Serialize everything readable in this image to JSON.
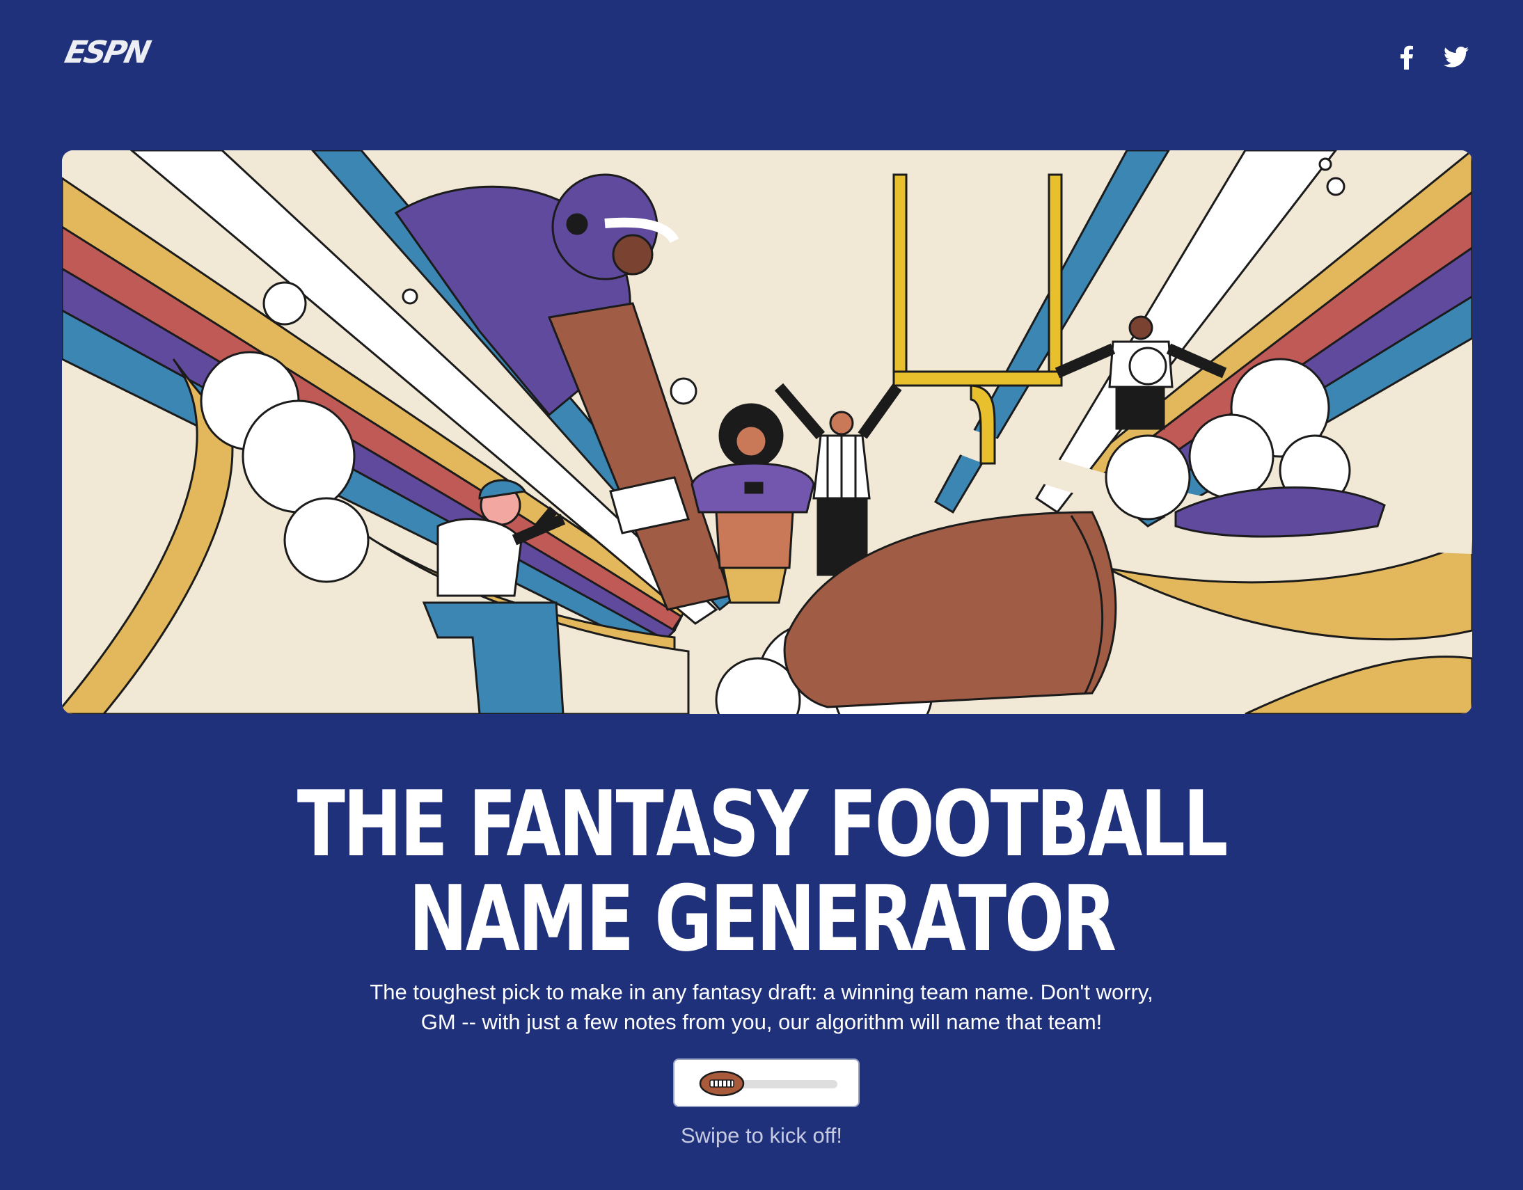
{
  "header": {
    "logo_text": "ESPN",
    "social": [
      {
        "name": "facebook-icon"
      },
      {
        "name": "twitter-icon"
      }
    ]
  },
  "hero": {
    "alt": "Illustration of fans, players and referees around a football and goal post",
    "colors": {
      "background": "#20317b",
      "purple": "#5f4a9e",
      "red": "#c05a57",
      "gold": "#e3b85c",
      "blue": "#3b86b3",
      "brown": "#a05c44",
      "cream": "#f1e8d6",
      "goalpost": "#e8c02e"
    }
  },
  "main": {
    "title_line1": "THE FANTASY FOOTBALL",
    "title_line2": "NAME GENERATOR",
    "subtitle": "The toughest pick to make in any fantasy draft: a winning team name. Don't worry, GM -- with just a few notes from you, our algorithm will name that team!",
    "slider": {
      "progress": 0
    },
    "hint": "Swipe to kick off!"
  }
}
